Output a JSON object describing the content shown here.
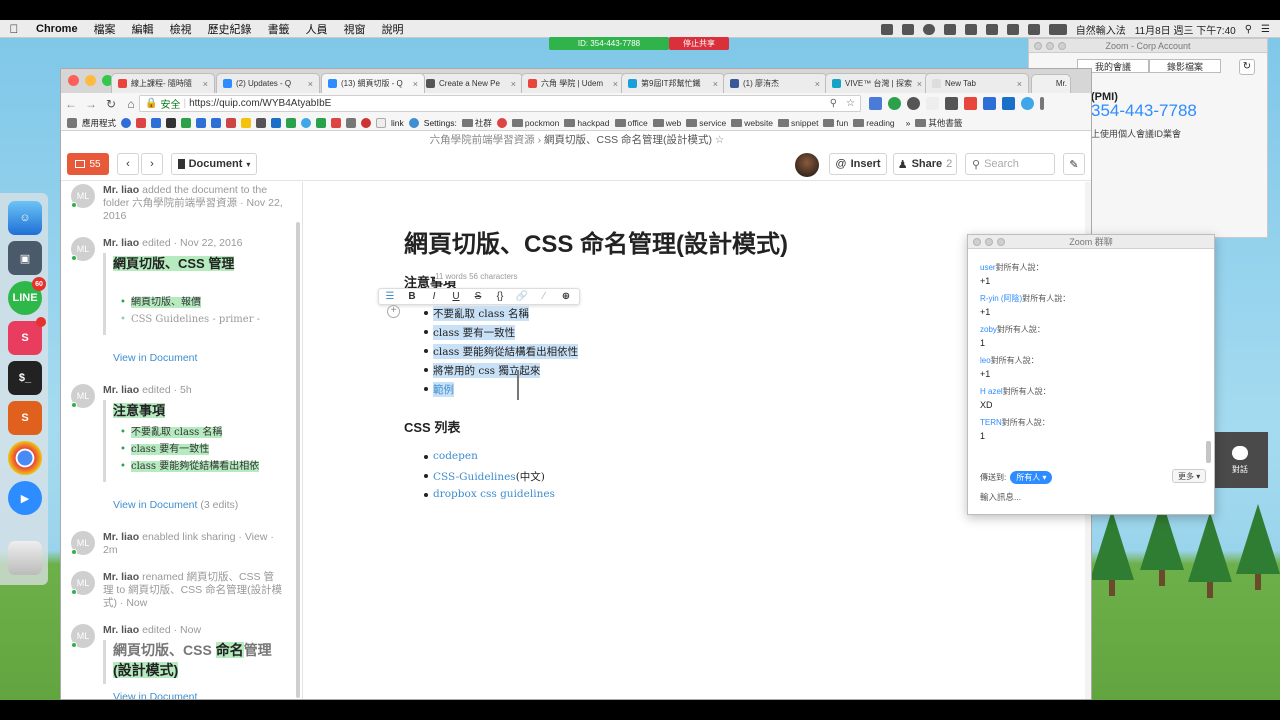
{
  "menubar": {
    "app": "Chrome",
    "items": [
      "檔案",
      "編輯",
      "檢視",
      "歷史紀錄",
      "書籤",
      "人員",
      "視窗",
      "說明"
    ],
    "input_method": "自然輸入法",
    "datetime": "11月8日 週三 下午7:40"
  },
  "zoom_share": {
    "meeting_id": "ID: 354-443-7788",
    "stop_label": "停止共享"
  },
  "dock": {
    "line_badge": "60"
  },
  "zoom_corp": {
    "title": "Zoom - Corp Account",
    "tab_meetings": "我的會議",
    "tab_recordings": "錄影檔案",
    "pmi_label": "(PMI)",
    "pmi_number": "354-443-7788",
    "pmi_desc": "上使用個人會議ID業會",
    "chat_button": "對話"
  },
  "browser": {
    "tabs": [
      {
        "title": "線上課程- 隨時隨",
        "color": "#e8453c"
      },
      {
        "title": "(2) Updates - Q",
        "color": "#2d8cff"
      },
      {
        "title": "(13) 網頁切版 - Q",
        "color": "#2d8cff"
      },
      {
        "title": "Create a New Pe",
        "color": "#555555"
      },
      {
        "title": "六角 學院 | Udem",
        "color": "#e8453c"
      },
      {
        "title": "第9屆IT邦幫忙鐵",
        "color": "#1aa0d8"
      },
      {
        "title": "(1) 廖洧杰",
        "color": "#3b5998"
      },
      {
        "title": "VIVE™ 台灣 | 探索",
        "color": "#17a2c8"
      },
      {
        "title": "New Tab",
        "color": "#dddddd"
      }
    ],
    "profile": "Mr.",
    "secure_label": "安全",
    "url": "https://quip.com/WYB4AtyabIbE",
    "bookmarks": {
      "apps": "應用程式",
      "link": "link",
      "settings": "Settings:",
      "folders": [
        "社群",
        "pockmon",
        "hackpad",
        "office",
        "web",
        "service",
        "website",
        "snippet",
        "fun",
        "reading"
      ],
      "other": "其他書籤"
    }
  },
  "quip": {
    "breadcrumb_folder": "六角學院前端學習資源",
    "breadcrumb_sep": "›",
    "breadcrumb_current": "網頁切版、CSS 命名管理(設計模式)",
    "star": "☆",
    "inbox_count": "55",
    "document_menu": "Document",
    "insert_label": "Insert",
    "share_label": "Share",
    "share_count": "2",
    "search_placeholder": "Search"
  },
  "activity": [
    {
      "initials": "ML",
      "actor": "Mr. liao",
      "text": "added the document to the folder 六角學院前端學習資源 · Nov 22, 2016"
    },
    {
      "initials": "ML",
      "actor": "Mr. liao",
      "text": "edited · Nov 22, 2016",
      "snippet_title": "網頁切版、CSS 管理",
      "snippet_items": [
        "網頁切版、報價",
        "CSS Guidelines - primer -"
      ],
      "view": "View in Document"
    },
    {
      "initials": "ML",
      "actor": "Mr. liao",
      "text": "edited · 5h",
      "snippet_title": "注意事項",
      "snippet_items": [
        "不要亂取 class 名稱",
        "class 要有一致性",
        "class 要能夠從結構看出相依"
      ],
      "view": "View in Document",
      "view_extra": "(3 edits)"
    },
    {
      "initials": "ML",
      "actor": "Mr. liao",
      "text": "enabled link sharing · View · 2m"
    },
    {
      "initials": "ML",
      "actor": "Mr. liao",
      "text": "renamed 網頁切版、CSS 管理 to 網頁切版、CSS 命名管理(設計模式) · Now"
    },
    {
      "initials": "ML",
      "actor": "Mr. liao",
      "text": "edited · Now",
      "snippet_pre": "網頁切版、CSS ",
      "snippet_hl1": "命名",
      "snippet_mid": "管理",
      "snippet_hl2": "(設計模式)",
      "view": "View in Document"
    }
  ],
  "document": {
    "title": "網頁切版、CSS 命名管理(設計模式)",
    "section1": "注意事項",
    "wordcount": "11 words  56 characters",
    "toolbar": [
      "☰",
      "B",
      "I",
      "U",
      "S",
      "{}",
      "🔗",
      "⁄",
      "⊕"
    ],
    "list1": [
      "不要亂取 class 名稱",
      "class 要有一致性",
      "class 要能夠從結構看出相依性",
      "將常用的 css 獨立起來",
      "範例"
    ],
    "section2": "CSS 列表",
    "list2_a": "codepen",
    "list2_b": "CSS-Guidelines",
    "list2_b_suffix": "(中文)",
    "list2_c": "dropbox css guidelines"
  },
  "zoom_chat": {
    "title": "Zoom 群聊",
    "said_suffix": "對所有人說：",
    "messages": [
      {
        "name": "user",
        "text": "+1"
      },
      {
        "name": "R-yin (阿陰)",
        "text": "+1"
      },
      {
        "name": "zoby",
        "text": "1"
      },
      {
        "name": "leo",
        "text": "+1"
      },
      {
        "name": "H azel",
        "text": "XD"
      },
      {
        "name": "TERN",
        "text": "1"
      }
    ],
    "send_to_label": "傳送到:",
    "send_to_value": "所有人 ▾",
    "more_label": "更多 ▾",
    "input_placeholder": "輸入訊息..."
  }
}
